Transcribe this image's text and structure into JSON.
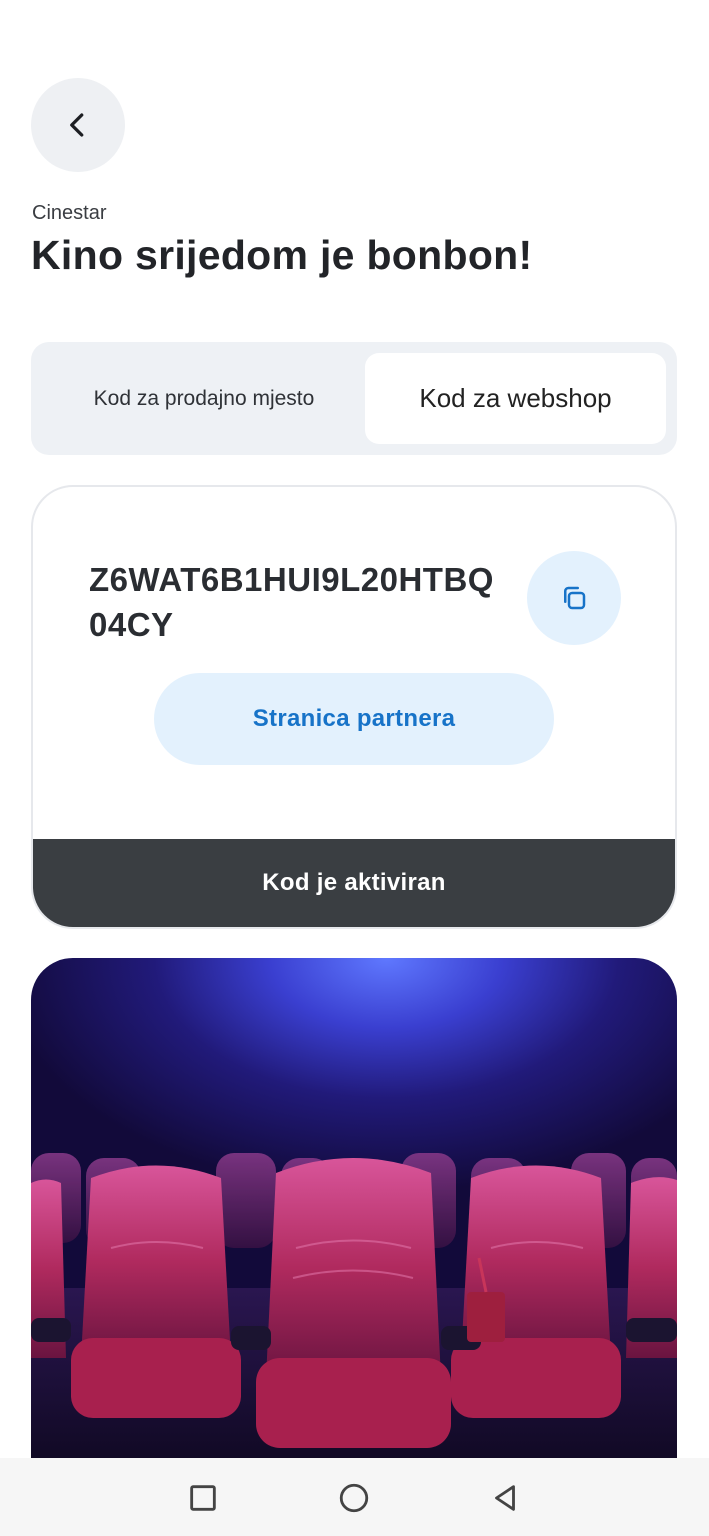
{
  "header": {
    "back_icon": "chevron-left-icon",
    "brand": "Cinestar",
    "title": "Kino srijedom je bonbon!"
  },
  "tabs": [
    {
      "label": "Kod za prodajno mjesto",
      "selected": false
    },
    {
      "label": "Kod za webshop",
      "selected": true
    }
  ],
  "code_card": {
    "code": "Z6WAT6B1HUI9L20HTBQ04CY",
    "copy_icon": "copy-icon",
    "partner_button": "Stranica partnera",
    "status": "Kod je aktiviran",
    "status_color": "#3a3e42",
    "accent_color": "#1773c8"
  },
  "image": {
    "subject": "cinema-seats-image"
  },
  "system_nav": {
    "recents_icon": "square-icon",
    "home_icon": "circle-icon",
    "back_icon": "triangle-back-icon"
  }
}
